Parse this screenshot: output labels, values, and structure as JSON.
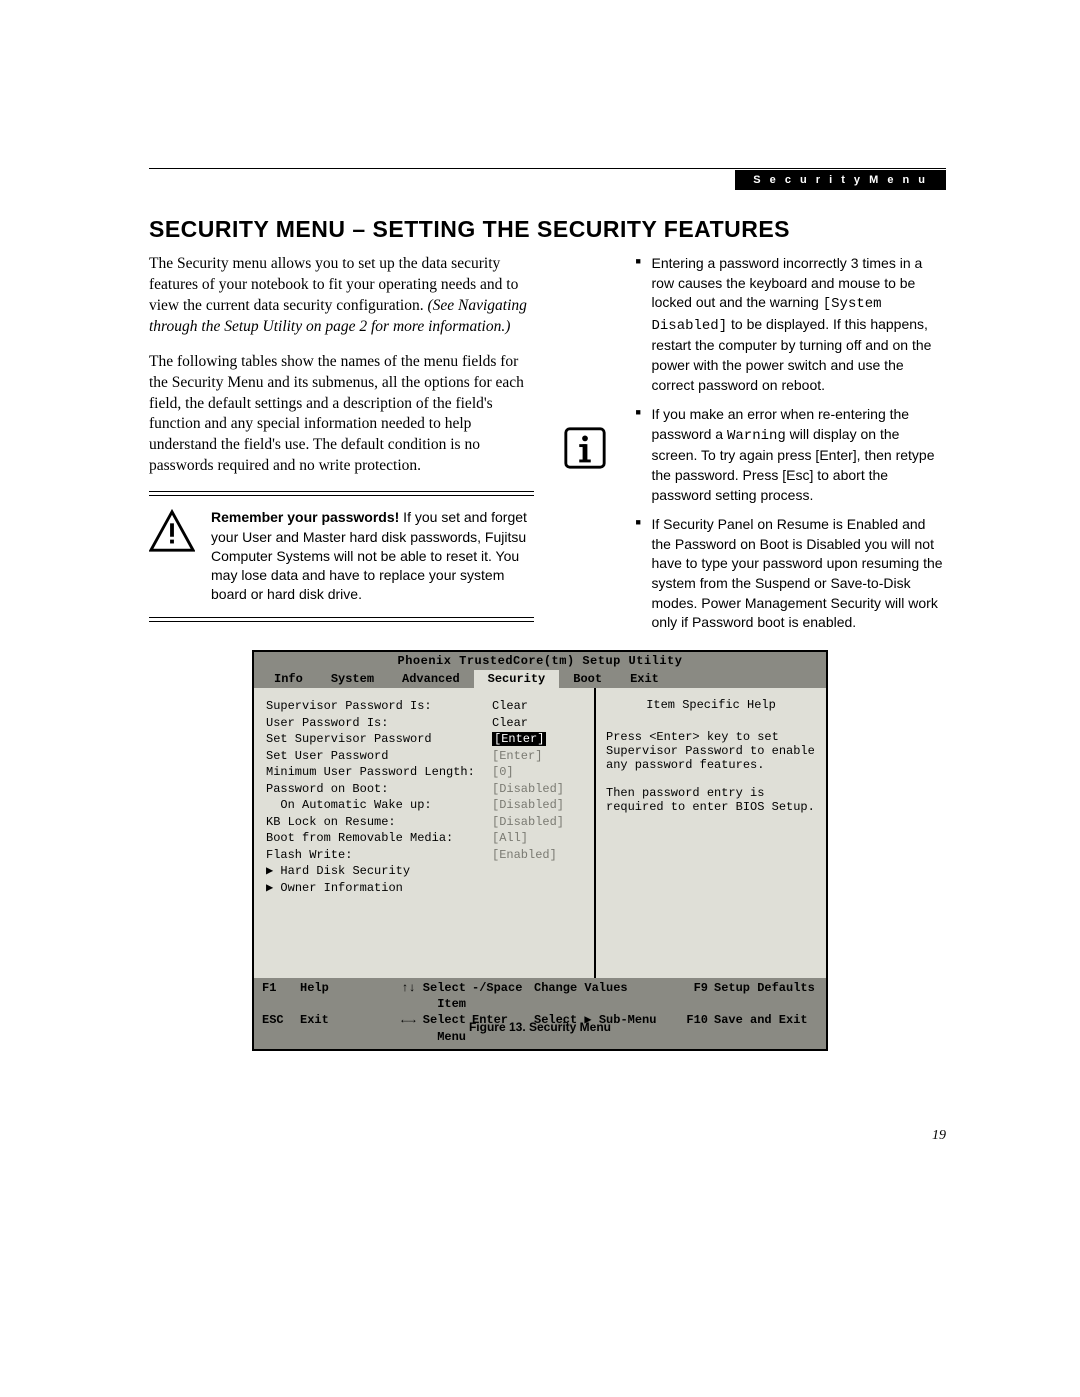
{
  "header_tab": "S e c u r i t y   M e n u",
  "title": "SECURITY MENU – SETTING THE SECURITY FEATURES",
  "intro": {
    "p1a": "The Security menu allows you to set up the data security features of your notebook to fit your operating needs and to view the current data security configuration. ",
    "p1b": "(See Navigating through the Setup Utility on page 2 for more information.)",
    "p2": "The following tables show the names of the menu fields for the Security Menu and its submenus, all the options for each field, the default settings and a description of the field's function and any special information needed to help understand the field's use. The default condition is no passwords required and no write protection."
  },
  "warn": {
    "lead": "Remember your passwords!",
    "body": " If you set and forget your User and Master hard disk passwords, Fujitsu Computer Systems will not be able to reset it. You may lose data and have to replace your system board or hard disk drive."
  },
  "info": {
    "b1a": "Entering a password incorrectly 3 times in a row causes the keyboard and mouse to be locked out and the warning ",
    "b1code": "[System Disabled]",
    "b1b": " to be displayed. If this happens, restart the computer by turning off and on the power with the power switch and use the correct password on reboot.",
    "b2a": "If you make an error when re-entering the password a ",
    "b2code": "Warning",
    "b2b": " will display on the screen. To try again press [Enter], then retype the password. Press [Esc] to abort the password setting process.",
    "b3": "If Security Panel on Resume is Enabled and the Password on Boot is Disabled you will not have to type your password upon resuming the system from the Suspend or Save-to-Disk modes. Power Management Security will work only if Password boot is enabled."
  },
  "bios": {
    "title": "Phoenix TrustedCore(tm) Setup Utility",
    "tabs": [
      "Info",
      "System",
      "Advanced",
      "Security",
      "Boot",
      "Exit"
    ],
    "rows": [
      {
        "l": "Supervisor Password Is:",
        "v": "Clear",
        "dim": false,
        "sel": false
      },
      {
        "l": "User Password Is:",
        "v": "Clear",
        "dim": false,
        "sel": false
      },
      {
        "l": "",
        "v": "",
        "dim": false,
        "sel": false
      },
      {
        "l": "Set Supervisor Password",
        "v": "[Enter]",
        "dim": false,
        "sel": true
      },
      {
        "l": "Set User Password",
        "v": "[Enter]",
        "dim": true,
        "sel": false
      },
      {
        "l": "Minimum User Password Length:",
        "v": "[0]",
        "dim": true,
        "sel": false
      },
      {
        "l": "Password on Boot:",
        "v": "[Disabled]",
        "dim": true,
        "sel": false
      },
      {
        "l": "  On Automatic Wake up:",
        "v": "[Disabled]",
        "dim": true,
        "sel": false
      },
      {
        "l": "KB Lock on Resume:",
        "v": "[Disabled]",
        "dim": true,
        "sel": false
      },
      {
        "l": "Boot from Removable Media:",
        "v": "[All]",
        "dim": true,
        "sel": false
      },
      {
        "l": "Flash Write:",
        "v": "[Enabled]",
        "dim": true,
        "sel": false
      },
      {
        "l": "▶ Hard Disk Security",
        "v": "",
        "dim": false,
        "sel": false
      },
      {
        "l": "▶ Owner Information",
        "v": "",
        "dim": false,
        "sel": false
      }
    ],
    "help": {
      "h": "Item Specific Help",
      "t": "Press <Enter> key to set Supervisor Password to enable any password features.\n\nThen password entry is required to enter BIOS Setup."
    },
    "foot": {
      "r1": {
        "k1": "F1",
        "a1": "Help",
        "k2": "↑↓ Select Item",
        "k3": "-/Space",
        "a3": "Change Values",
        "k4": "F9",
        "a4": "Setup Defaults"
      },
      "r2": {
        "k1": "ESC",
        "a1": "Exit",
        "k2": "←→ Select Menu",
        "k3": "Enter",
        "a3": "Select ▶ Sub-Menu",
        "k4": "F10",
        "a4": "Save and Exit"
      }
    }
  },
  "caption": "Figure 13.  Security Menu",
  "pagenum": "19"
}
